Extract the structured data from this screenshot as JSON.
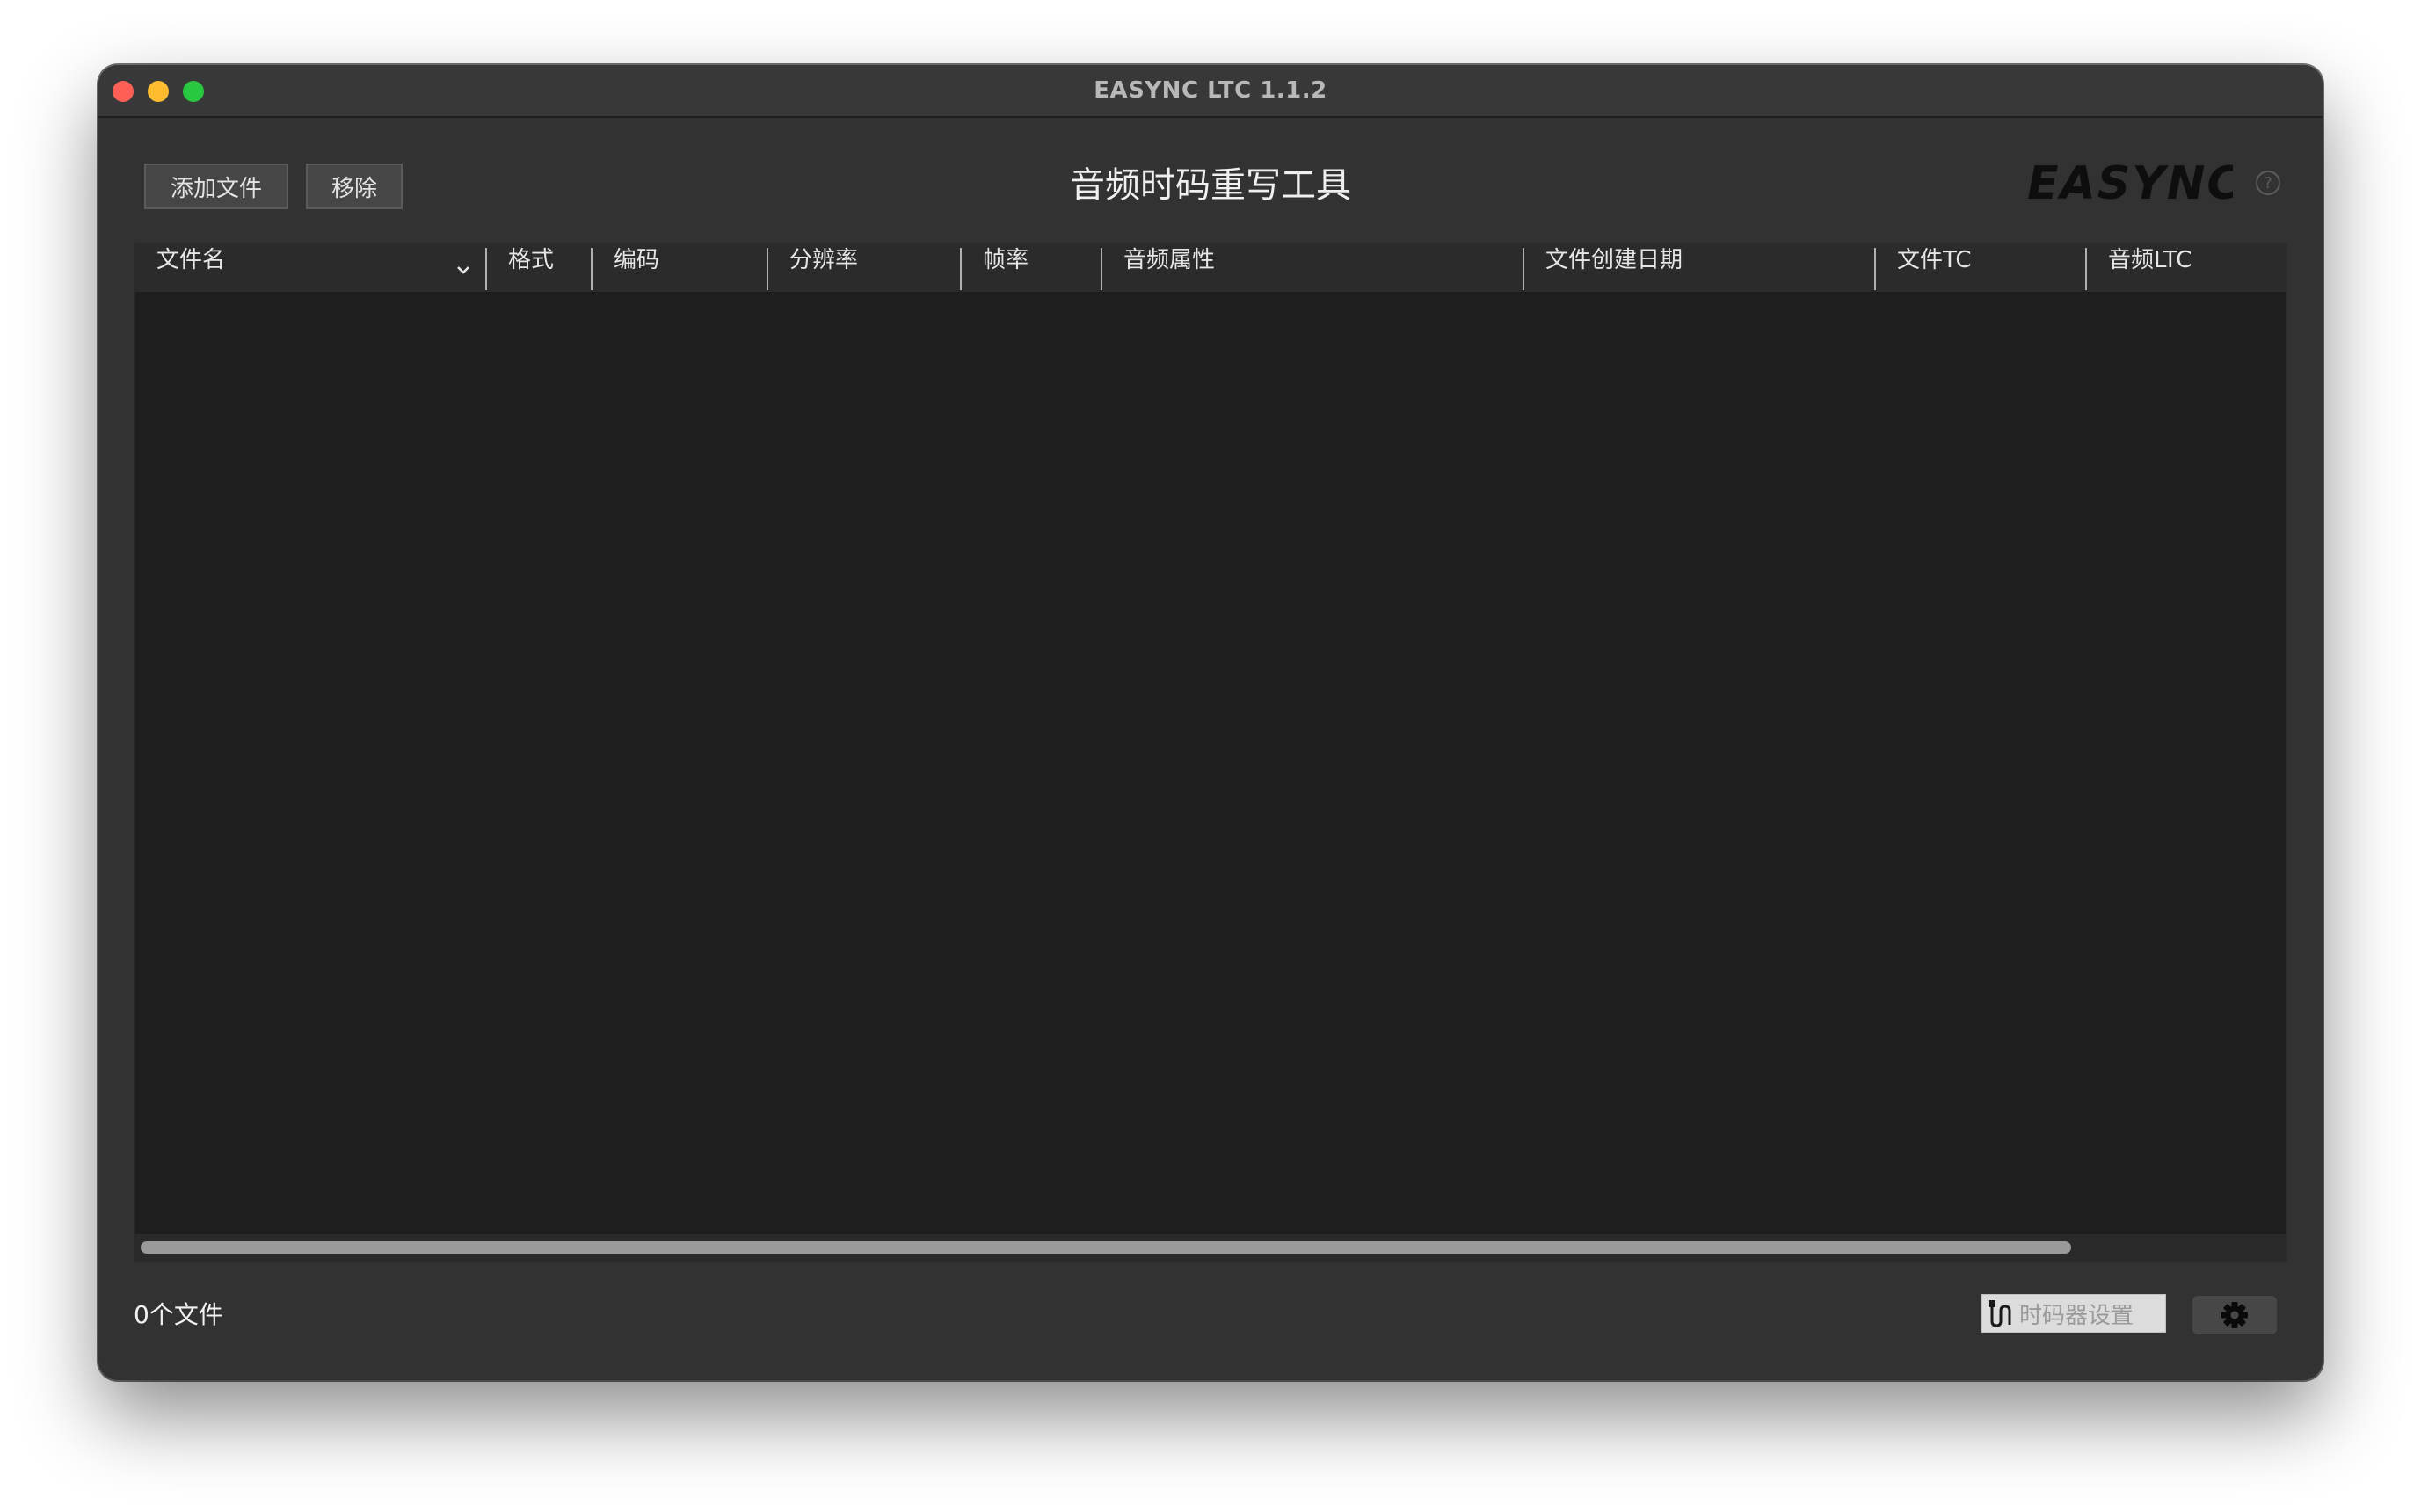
{
  "window": {
    "title": "EASYNC LTC 1.1.2"
  },
  "toolbar": {
    "add_file_label": "添加文件",
    "remove_label": "移除",
    "page_title": "音频时码重写工具",
    "logo_text": "EASYNC",
    "help_label": "?"
  },
  "table": {
    "columns": [
      {
        "label": "文件名"
      },
      {
        "label": "格式"
      },
      {
        "label": "编码"
      },
      {
        "label": "分辨率"
      },
      {
        "label": "帧率"
      },
      {
        "label": "音频属性"
      },
      {
        "label": "文件创建日期"
      },
      {
        "label": "文件TC"
      },
      {
        "label": "音频LTC"
      }
    ],
    "rows": [],
    "sort_icon": "chevron-down-icon"
  },
  "footer": {
    "file_count": "0个文件",
    "timecode_settings_label": "时码器设置",
    "timecode_icon": "cable-icon",
    "settings_icon": "gear-icon"
  },
  "colors": {
    "window_bg": "#323232",
    "table_bg": "#1e1e1e",
    "close": "#ff5f57",
    "minimize": "#febc2e",
    "maximize": "#28c840"
  }
}
